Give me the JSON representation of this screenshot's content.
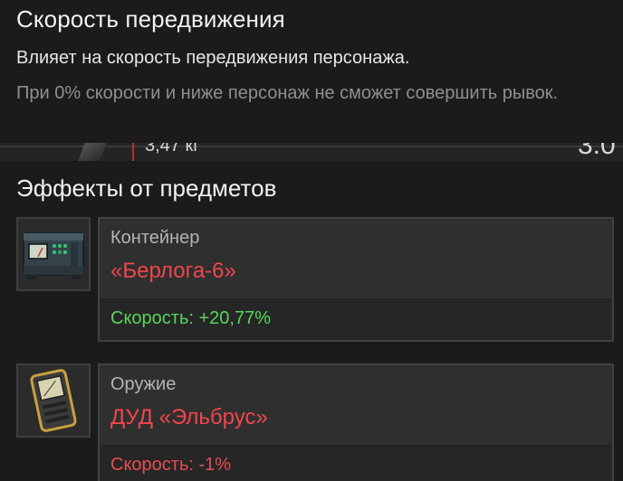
{
  "tooltip": {
    "title": "Скорость передвижения",
    "description": "Влияет на скорость передвижения персонажа.",
    "note": "При 0% скорости и ниже персонаж не сможет совершить рывок."
  },
  "background_peek": {
    "weight_text": "3,47 кг",
    "right_text": "3.0"
  },
  "effects": {
    "section_title": "Эффекты от предметов",
    "items": [
      {
        "icon": "container-icon",
        "category": "Контейнер",
        "name": "«Берлога-6»",
        "effect_label": "Скорость: +20,77%",
        "effect_sign": "positive"
      },
      {
        "icon": "detector-icon",
        "category": "Оружие",
        "name": "ДУД «Эльбрус»",
        "effect_label": "Скорость: -1%",
        "effect_sign": "negative"
      }
    ]
  },
  "colors": {
    "positive": "#57d65a",
    "negative": "#e84c4f",
    "item_name": "#f0464c",
    "panel": "#2f2f2f",
    "background": "#1b1b1b"
  }
}
